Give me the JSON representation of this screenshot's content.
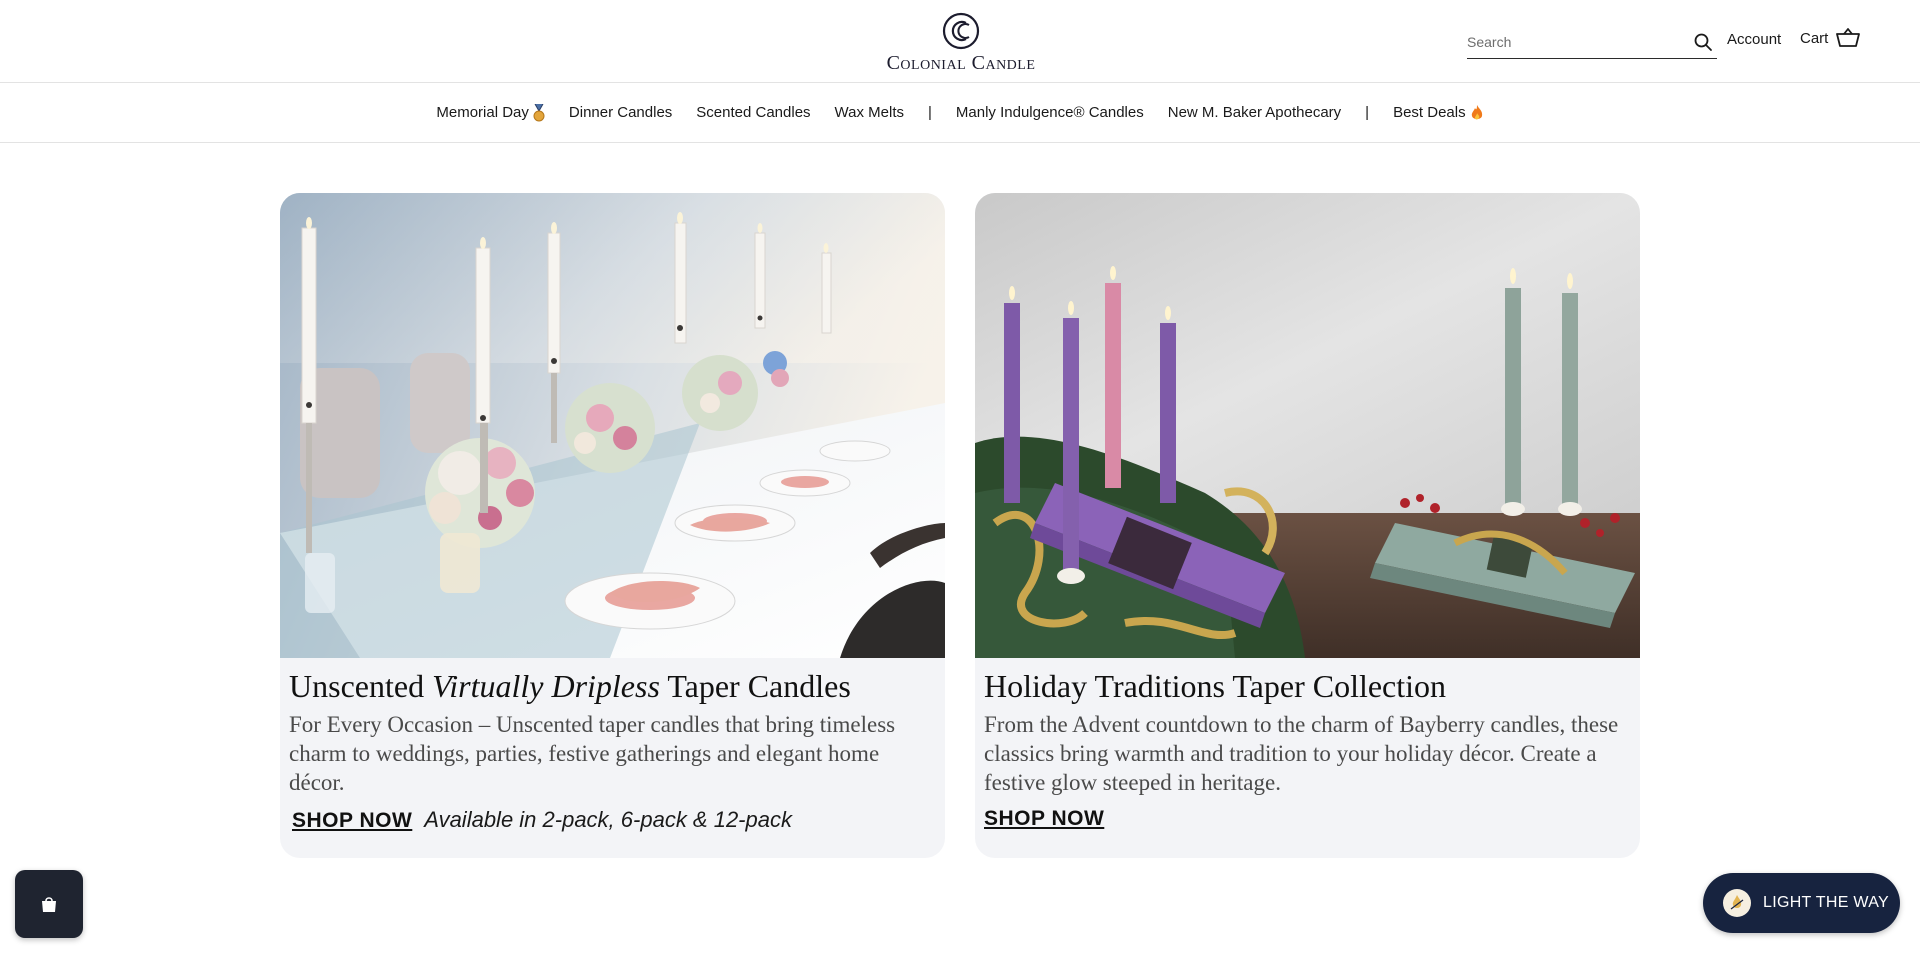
{
  "header": {
    "logo_text": "Colonial Candle",
    "search_placeholder": "Search",
    "account_label": "Account",
    "cart_label": "Cart"
  },
  "nav": {
    "items": [
      {
        "label": "Memorial Day",
        "icon": "medal-icon"
      },
      {
        "label": "Dinner Candles"
      },
      {
        "label": "Scented Candles"
      },
      {
        "label": "Wax Melts"
      },
      {
        "label": "|"
      },
      {
        "label": "Manly Indulgence® Candles"
      },
      {
        "label": "New M. Baker Apothecary"
      },
      {
        "label": "|"
      },
      {
        "label": "Best Deals",
        "icon": "flame-icon"
      }
    ]
  },
  "cards": [
    {
      "title_part1": "Unscented ",
      "title_italic": "Virtually Dripless",
      "title_part2": " Taper Candles",
      "description": "For Every Occasion – Unscented taper candles that bring timeless charm to weddings, parties, festive gatherings and elegant home décor.",
      "cta": "SHOP NOW",
      "availability": "Available in 2-pack, 6-pack & 12-pack"
    },
    {
      "title": "Holiday Traditions Taper Collection",
      "description": "From the Advent countdown to the charm of Bayberry candles, these classics bring warmth and tradition to your holiday décor. Create a festive glow steeped in heritage.",
      "cta": "SHOP NOW"
    }
  ],
  "widgets": {
    "light_the_way": "LIGHT THE WAY",
    "shop_badge_icon": "shopping-bag-icon"
  },
  "colors": {
    "navy": "#17233f",
    "card_bg": "#f3f4f7",
    "border": "#e3e3e3"
  }
}
